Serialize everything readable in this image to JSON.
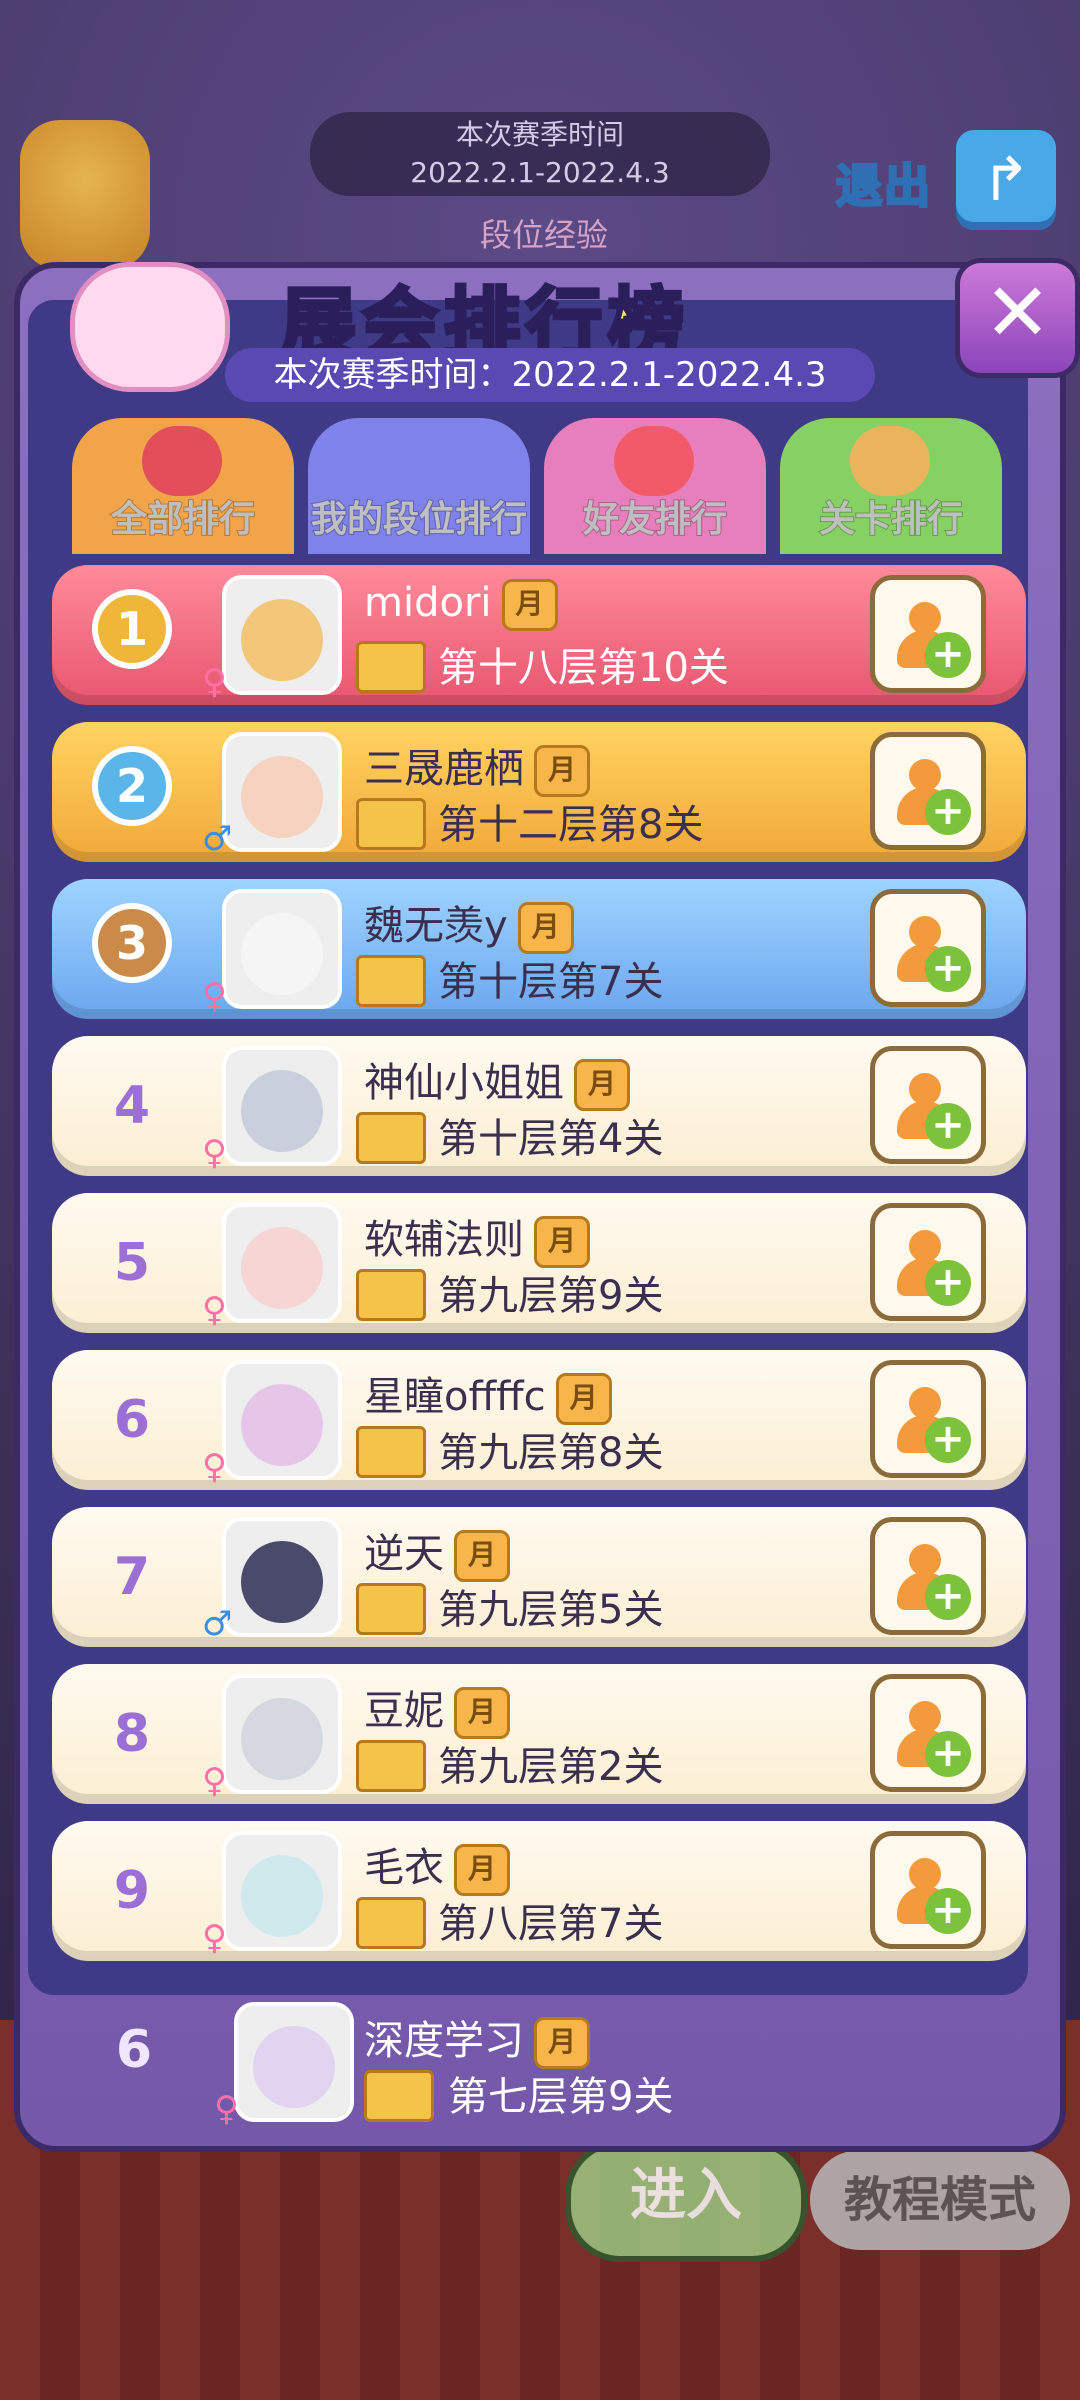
{
  "background": {
    "season_label": "本次赛季时间",
    "season_range": "2022.2.1-2022.4.3",
    "rank_exp_label": "段位经验",
    "exit_label": "退出"
  },
  "panel": {
    "title": "展会排行榜",
    "season_text": "本次赛季时间：2022.2.1-2022.4.3",
    "tabs": [
      {
        "label": "全部排行",
        "color": "#f2a44a"
      },
      {
        "label": "我的段位排行",
        "color": "#7f82e8"
      },
      {
        "label": "好友排行",
        "color": "#e77fbc"
      },
      {
        "label": "关卡排行",
        "color": "#87d164"
      }
    ]
  },
  "rows": [
    {
      "rank": "1",
      "name": "midori",
      "level": "第十八层第10关",
      "gender": "♀"
    },
    {
      "rank": "2",
      "name": "三晟鹿栖",
      "level": "第十二层第8关",
      "gender": "♂"
    },
    {
      "rank": "3",
      "name": "魏无羡y",
      "level": "第十层第7关",
      "gender": "♀"
    },
    {
      "rank": "4",
      "name": "神仙小姐姐",
      "level": "第十层第4关",
      "gender": "♀"
    },
    {
      "rank": "5",
      "name": "软辅法则",
      "level": "第九层第9关",
      "gender": "♀"
    },
    {
      "rank": "6",
      "name": "星瞳offffc",
      "level": "第九层第8关",
      "gender": "♀"
    },
    {
      "rank": "7",
      "name": "逆天",
      "level": "第九层第5关",
      "gender": "♂"
    },
    {
      "rank": "8",
      "name": "豆妮",
      "level": "第九层第2关",
      "gender": "♀"
    },
    {
      "rank": "9",
      "name": "毛衣",
      "level": "第八层第7关",
      "gender": "♀"
    }
  ],
  "self": {
    "rank": "6",
    "name": "深度学习",
    "level": "第七层第9关",
    "gender": "♀"
  },
  "badges": {
    "moon": "月"
  },
  "buttons": {
    "enter": "进入",
    "tutorial": "教程模式"
  }
}
